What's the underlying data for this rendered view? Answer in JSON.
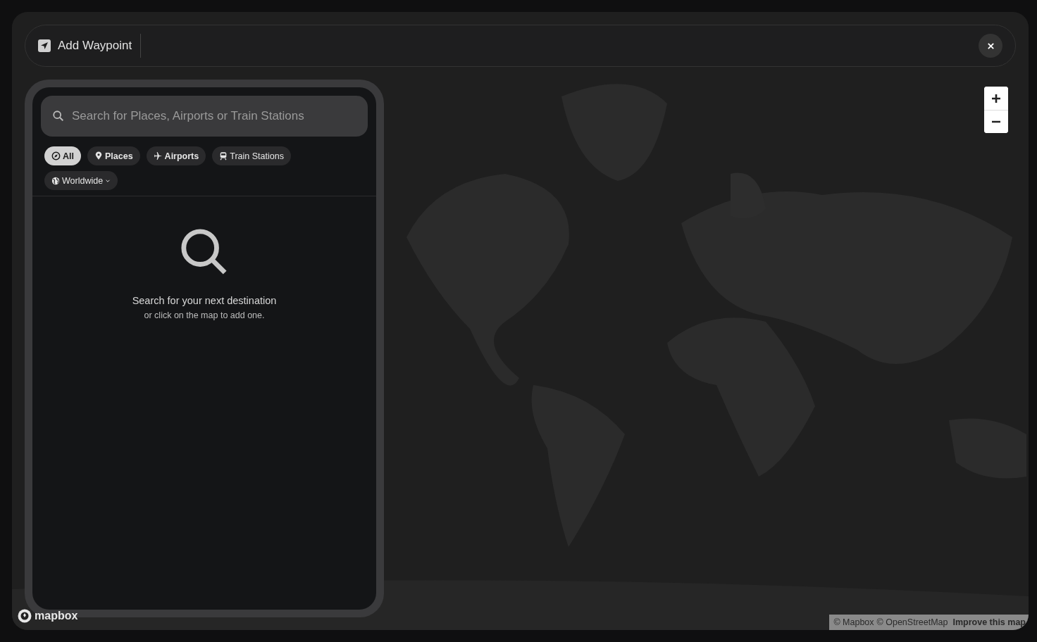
{
  "header": {
    "title": "Add Waypoint"
  },
  "search": {
    "placeholder": "Search for Places, Airports or Train Stations"
  },
  "filters": [
    {
      "label": "All",
      "kind": "all",
      "selected": true
    },
    {
      "label": "Places",
      "kind": "place",
      "selected": false
    },
    {
      "label": "Airports",
      "kind": "airport",
      "selected": false
    },
    {
      "label": "Train Stations",
      "kind": "train",
      "selected": false
    }
  ],
  "region": {
    "label": "Worldwide"
  },
  "empty_state": {
    "title": "Search for your next destination",
    "subtitle": "or click on the map to add one."
  },
  "map": {
    "kind": "picture",
    "logo": "mapbox",
    "attribution": [
      "© Mapbox",
      "© OpenStreetMap"
    ],
    "improve_link": "Improve this map"
  }
}
